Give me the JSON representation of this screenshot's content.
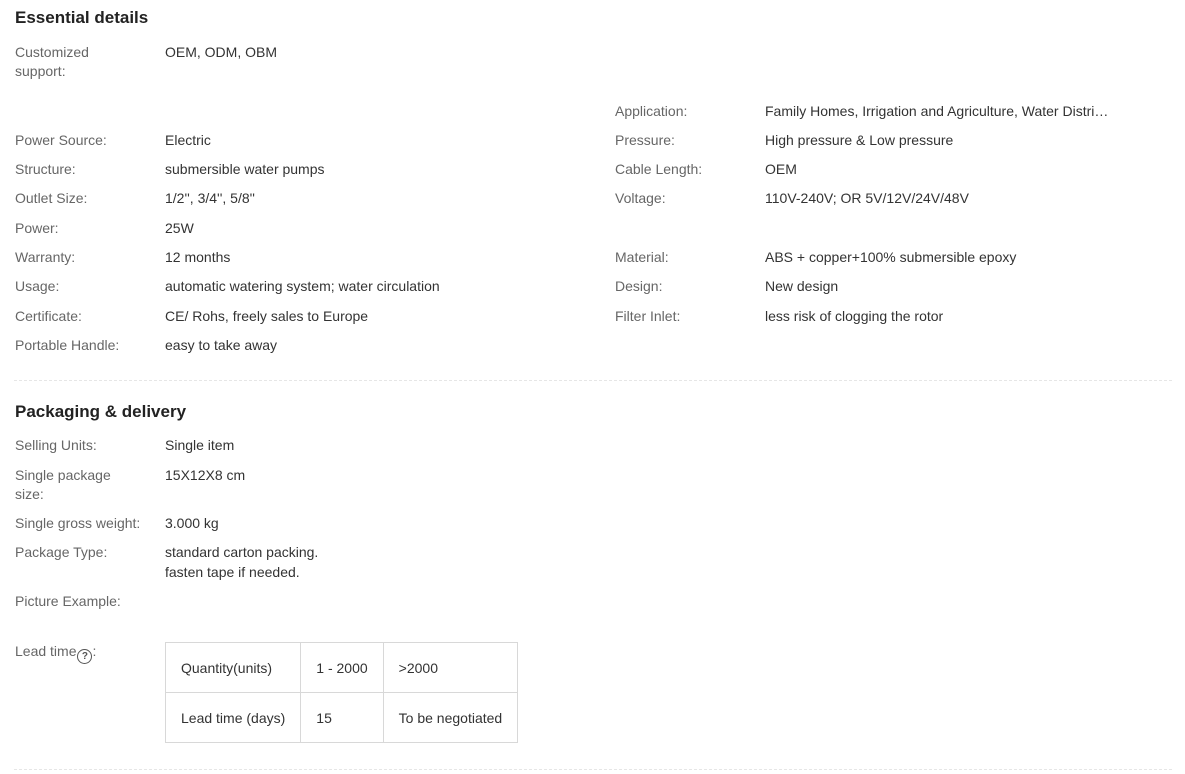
{
  "essential": {
    "title": "Essential details",
    "customized_label": "Customized support:",
    "customized_value": "OEM, ODM, OBM",
    "application_label": "Application:",
    "application_value": "Family Homes, Irrigation and Agriculture, Water Distri…",
    "left": [
      {
        "label": "Power Source:",
        "value": "Electric"
      },
      {
        "label": "Structure:",
        "value": "submersible water pumps"
      },
      {
        "label": "Outlet Size:",
        "value": "1/2'', 3/4'', 5/8''"
      },
      {
        "label": "Power:",
        "value": "25W"
      },
      {
        "label": "Warranty:",
        "value": "12 months"
      },
      {
        "label": "Usage:",
        "value": "automatic watering system; water circulation"
      },
      {
        "label": "Certificate:",
        "value": "CE/ Rohs, freely sales to Europe"
      },
      {
        "label": "Portable Handle:",
        "value": "easy to take away"
      }
    ],
    "right": [
      {
        "label": "Pressure:",
        "value": "High pressure & Low pressure"
      },
      {
        "label": "Cable Length:",
        "value": "OEM"
      },
      {
        "label": "Voltage:",
        "value": "110V-240V; OR 5V/12V/24V/48V"
      },
      {
        "label": "Material:",
        "value": "ABS + copper+100% submersible epoxy"
      },
      {
        "label": "Design:",
        "value": "New design"
      },
      {
        "label": "Filter Inlet:",
        "value": "less risk of clogging the rotor"
      }
    ]
  },
  "packaging": {
    "title": "Packaging & delivery",
    "selling_units_label": "Selling Units:",
    "selling_units_value": "Single item",
    "package_size_label": "Single package size:",
    "package_size_value": "15X12X8 cm",
    "gross_weight_label": "Single gross weight:",
    "gross_weight_value": "3.000 kg",
    "package_type_label": "Package Type:",
    "package_type_value_1": "standard carton packing.",
    "package_type_value_2": "fasten tape if needed.",
    "picture_label": "Picture Example:",
    "lead_time_label": "Lead time",
    "lead_time_colon": ":",
    "help_icon": "question-circle-icon",
    "lead_table": {
      "header": [
        "Quantity(units)",
        "1 - 2000",
        ">2000"
      ],
      "row": [
        "Lead time (days)",
        "15",
        "To be negotiated"
      ]
    }
  }
}
